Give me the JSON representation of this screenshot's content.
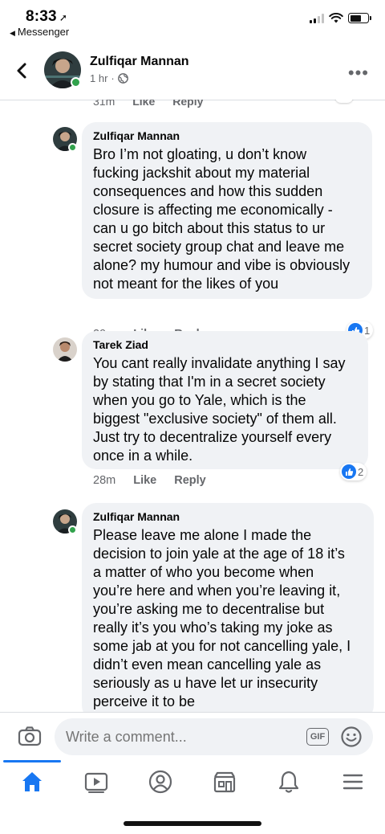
{
  "status_bar": {
    "time": "8:33",
    "back_app": "Messenger"
  },
  "header": {
    "name": "Zulfiqar Mannan",
    "time": "1 hr",
    "separator": "·",
    "more": "•••"
  },
  "cut_comment": {
    "time": "31m",
    "like": "Like",
    "reply": "Reply"
  },
  "comments": [
    {
      "name": "Zulfiqar Mannan",
      "text": "Bro I’m not gloating, u don’t know\nfucking jackshit about my material\nconsequences and how this sudden\nclosure is affecting me economically -\ncan u go bitch about this status to ur\nsecret society group chat and leave me\nalone? my humour and vibe is obviously\nnot meant for the likes of you",
      "time": "29m",
      "like": "Like",
      "reply": "Reply",
      "reaction_count": "1"
    },
    {
      "name": "Tarek Ziad",
      "text": "You cant really invalidate anything I say\nby stating that I'm in a secret society\nwhen you go to Yale, which is the\nbiggest \"exclusive society\" of them all.\nJust try to decentralize yourself every\nonce in a while.",
      "time": "28m",
      "like": "Like",
      "reply": "Reply",
      "reaction_count": "2"
    },
    {
      "name": "Zulfiqar Mannan",
      "text": "Please leave me alone I made the\ndecision to join yale at the age of 18 it’s\na matter of who you become when\nyou’re here and when you’re leaving it,\nyou’re asking me to decentralise but\nreally it’s you who’s taking my joke as\nsome jab at you for not cancelling yale, I\ndidn’t even mean cancelling yale as\nseriously as u have let ur insecurity\nperceive it to be"
    }
  ],
  "composer": {
    "placeholder": "Write a comment...",
    "gif_label": "GIF"
  },
  "nav": {
    "items": [
      "home",
      "watch",
      "profile",
      "marketplace",
      "notifications",
      "menu"
    ],
    "active": "home"
  },
  "colors": {
    "accent": "#1877f2",
    "bubble": "#f0f2f5",
    "online": "#31a24c",
    "secondary_text": "#65676b"
  }
}
